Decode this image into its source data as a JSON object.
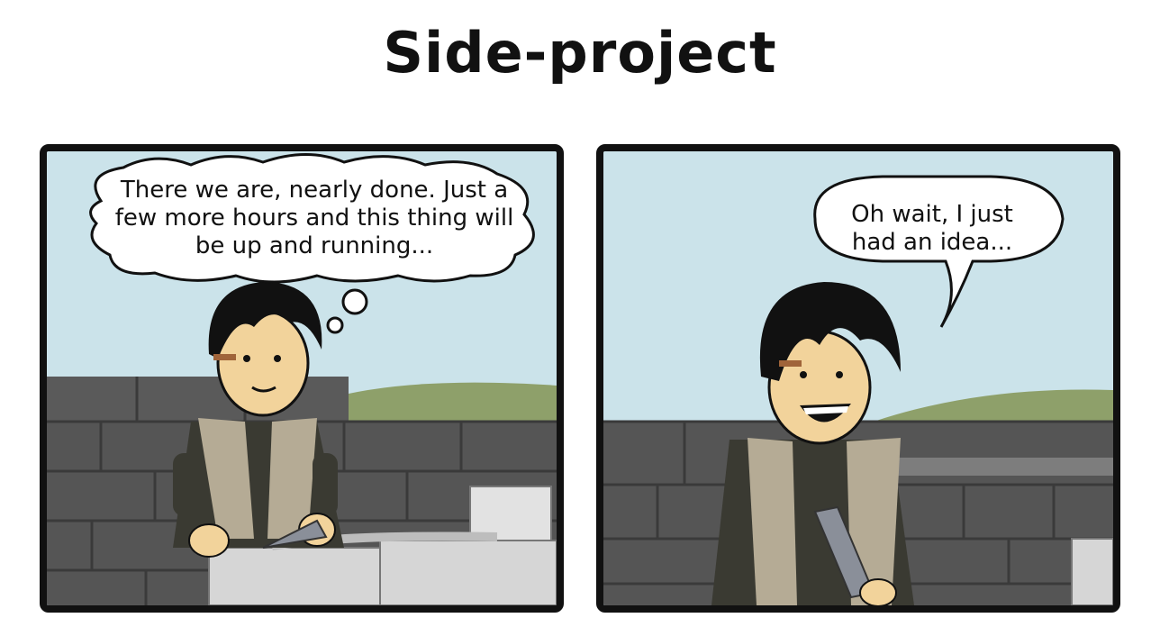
{
  "comic": {
    "title": "Side-project",
    "panels": [
      {
        "balloon_type": "thought",
        "text": "There we are, nearly done. Just a few more hours and this thing will be up and running..."
      },
      {
        "balloon_type": "speech",
        "text": "Oh wait, I just had an idea..."
      }
    ]
  },
  "colors": {
    "sky": "#cbe3ea",
    "wall": "#555555",
    "hill": "#8ea06a",
    "skin": "#f2d39b",
    "hair": "#111111",
    "vest": "#b5ab95",
    "shirt": "#3a3a32",
    "stone": "#d8d8d8"
  }
}
